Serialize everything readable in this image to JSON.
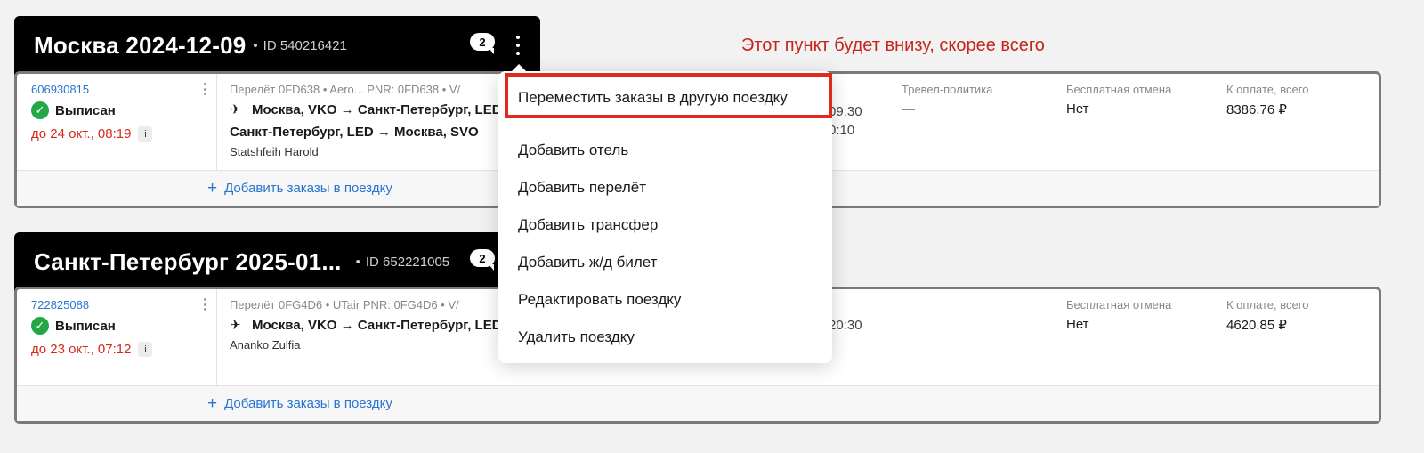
{
  "annotation": "Этот пункт будет внизу, скорее всего",
  "trips": [
    {
      "title": "Москва 2024-12-09",
      "id_text": "ID 540216421",
      "chat_count": "2",
      "order": {
        "number": "606930815",
        "status": "Выписан",
        "deadline": "до 24 окт., 08:19",
        "info": "i",
        "flight_meta": "Перелёт 0FD638 • Aero...  PNR: 0FD638 • V/",
        "routes": [
          "Москва, VKO → Санкт-Петербург, LED",
          "Санкт-Петербург, LED → Москва, SVO"
        ],
        "passenger": "Statshfeih Harold",
        "times": [
          "09:30",
          "0:10"
        ],
        "policy_title": "Тревел-политика",
        "policy_value": "—",
        "cancel_title": "Бесплатная отмена",
        "cancel_value": "Нет",
        "pay_title": "К оплате, всего",
        "pay_value": "8386.76 ₽"
      },
      "add_orders": "Добавить заказы в поездку"
    },
    {
      "title": "Санкт-Петербург 2025-01...",
      "id_text": "ID 652221005",
      "chat_count": "2",
      "order": {
        "number": "722825088",
        "status": "Выписан",
        "deadline": "до 23 окт., 07:12",
        "info": "i",
        "flight_meta": "Перелёт 0FG4D6 • UTair   PNR: 0FG4D6 • V/",
        "routes": [
          "Москва, VKO → Санкт-Петербург, LED"
        ],
        "passenger": "Ananko Zulfia",
        "times": [
          "20:30"
        ],
        "cancel_title": "Бесплатная отмена",
        "cancel_value": "Нет",
        "pay_title": "К оплате, всего",
        "pay_value": "4620.85 ₽"
      },
      "add_orders": "Добавить заказы в поездку"
    }
  ],
  "menu": {
    "items": [
      "Переместить заказы в другую поездку",
      "Добавить отель",
      "Добавить перелёт",
      "Добавить трансфер",
      "Добавить ж/д билет",
      "Редактировать поездку",
      "Удалить поездку"
    ]
  },
  "icons": {
    "plane": "plane-icon",
    "check": "check-circle-icon",
    "plus": "plus-icon",
    "chat": "chat-bubble-icon",
    "kebab": "kebab-menu-icon"
  },
  "colors": {
    "accent_link": "#2a74d4",
    "deadline": "#d42a1e",
    "status_ok": "#24a846",
    "highlight": "#e02a1c"
  }
}
